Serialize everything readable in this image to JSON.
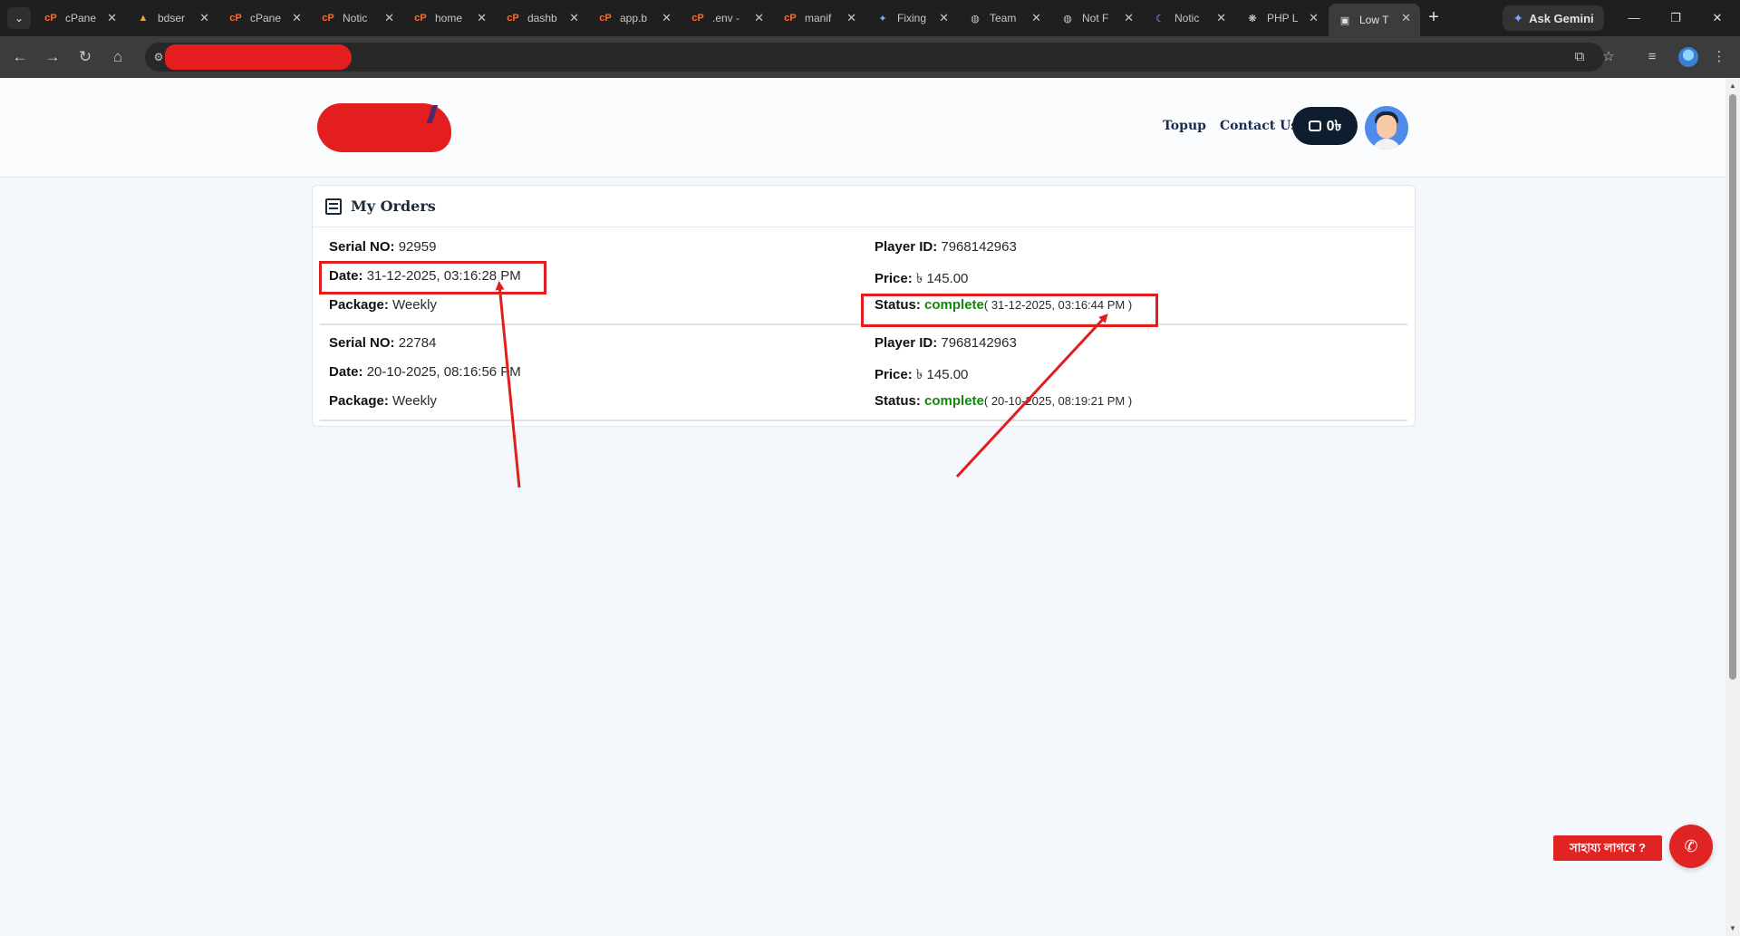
{
  "browser": {
    "tabs": [
      {
        "label": "cPane",
        "icon": "cpanel-icon",
        "active": false
      },
      {
        "label": "bdser",
        "icon": "server-icon",
        "active": false
      },
      {
        "label": "cPane",
        "icon": "cpanel-icon",
        "active": false
      },
      {
        "label": "Notic",
        "icon": "cpanel-icon",
        "active": false
      },
      {
        "label": "home",
        "icon": "cpanel-icon",
        "active": false
      },
      {
        "label": "dashb",
        "icon": "cpanel-icon",
        "active": false
      },
      {
        "label": "app.b",
        "icon": "cpanel-icon",
        "active": false
      },
      {
        "label": ".env -",
        "icon": "cpanel-icon",
        "active": false
      },
      {
        "label": "manif",
        "icon": "cpanel-icon",
        "active": false
      },
      {
        "label": "Fixing",
        "icon": "gemini-icon",
        "active": false
      },
      {
        "label": "Team",
        "icon": "globe-icon",
        "active": false
      },
      {
        "label": "Not F",
        "icon": "globe-icon",
        "active": false
      },
      {
        "label": "Notic",
        "icon": "moon-icon",
        "active": false
      },
      {
        "label": "PHP L",
        "icon": "openai-icon",
        "active": false
      },
      {
        "label": "Low T",
        "icon": "page-icon",
        "active": true
      }
    ],
    "ask_gemini": "Ask Gemini",
    "accent_redact": "#e41e1e"
  },
  "header": {
    "nav": {
      "topup": "Topup",
      "contact": "Contact Us"
    },
    "wallet_balance": "0৳"
  },
  "orders_card": {
    "title": "My Orders",
    "labels": {
      "serial": "Serial NO:",
      "date": "Date:",
      "package": "Package:",
      "player": "Player ID:",
      "price": "Price:",
      "status": "Status:"
    },
    "orders": [
      {
        "serial": "92959",
        "date": "31-12-2025, 03:16:28 PM",
        "package": "Weekly",
        "player_id": "7968142963",
        "price": "৳ 145.00",
        "status": "complete",
        "status_time": "( 31-12-2025, 03:16:44 PM )"
      },
      {
        "serial": "22784",
        "date": "20-10-2025, 08:16:56 PM",
        "package": "Weekly",
        "player_id": "7968142963",
        "price": "৳ 145.00",
        "status": "complete",
        "status_time": "( 20-10-2025, 08:19:21 PM )"
      }
    ],
    "status_color": "#14860f"
  },
  "help": {
    "label": "সাহায্য লাগবে ?",
    "icon": "phone-icon"
  },
  "annotation_color": "#e01e1e"
}
